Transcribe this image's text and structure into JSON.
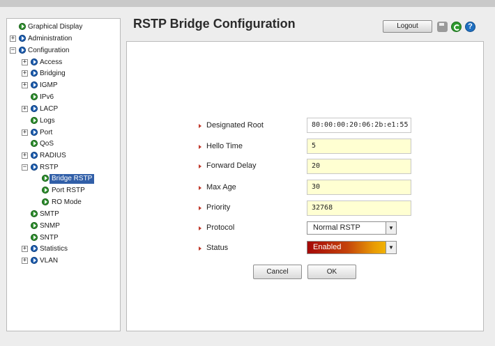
{
  "page": {
    "title": "RSTP Bridge Configuration"
  },
  "header": {
    "logout_label": "Logout",
    "help_glyph": "?"
  },
  "sidebar": {
    "items": [
      {
        "label": "Graphical Display",
        "expander": "",
        "icon": "leaf"
      },
      {
        "label": "Administration",
        "expander": "+",
        "icon": "node"
      },
      {
        "label": "Configuration",
        "expander": "−",
        "icon": "node"
      },
      {
        "label": "Access",
        "expander": "+",
        "icon": "node"
      },
      {
        "label": "Bridging",
        "expander": "+",
        "icon": "node"
      },
      {
        "label": "IGMP",
        "expander": "+",
        "icon": "node"
      },
      {
        "label": "IPv6",
        "expander": "",
        "icon": "leaf"
      },
      {
        "label": "LACP",
        "expander": "+",
        "icon": "node"
      },
      {
        "label": "Logs",
        "expander": "",
        "icon": "leaf"
      },
      {
        "label": "Port",
        "expander": "+",
        "icon": "node"
      },
      {
        "label": "QoS",
        "expander": "",
        "icon": "leaf"
      },
      {
        "label": "RADIUS",
        "expander": "+",
        "icon": "node"
      },
      {
        "label": "RSTP",
        "expander": "−",
        "icon": "node"
      },
      {
        "label": "Bridge RSTP",
        "expander": "",
        "icon": "leaf",
        "selected": true
      },
      {
        "label": "Port RSTP",
        "expander": "",
        "icon": "leaf"
      },
      {
        "label": "RO Mode",
        "expander": "",
        "icon": "leaf"
      },
      {
        "label": "SMTP",
        "expander": "",
        "icon": "leaf"
      },
      {
        "label": "SNMP",
        "expander": "",
        "icon": "leaf"
      },
      {
        "label": "SNTP",
        "expander": "",
        "icon": "leaf"
      },
      {
        "label": "Statistics",
        "expander": "+",
        "icon": "node"
      },
      {
        "label": "VLAN",
        "expander": "+",
        "icon": "node"
      }
    ]
  },
  "form": {
    "designated_root": {
      "label": "Designated Root",
      "value": "80:00:00:20:06:2b:e1:55"
    },
    "hello_time": {
      "label": "Hello Time",
      "value": "5"
    },
    "forward_delay": {
      "label": "Forward Delay",
      "value": "20"
    },
    "max_age": {
      "label": "Max Age",
      "value": "30"
    },
    "priority": {
      "label": "Priority",
      "value": "32768"
    },
    "protocol": {
      "label": "Protocol",
      "value": "Normal RSTP"
    },
    "status": {
      "label": "Status",
      "value": "Enabled"
    },
    "cancel_label": "Cancel",
    "ok_label": "OK"
  },
  "colors": {
    "selected_bg": "#315fa8",
    "field_yellow": "#ffffd2",
    "arrow_red": "#c0392b"
  }
}
